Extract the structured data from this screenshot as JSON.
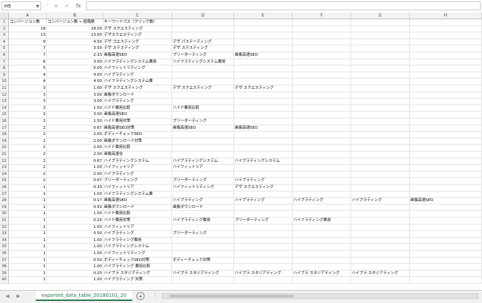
{
  "formula_bar": {
    "name_box": "H9",
    "cancel_icon": "×",
    "enter_icon": "✓",
    "fx_label": "fx",
    "formula": ""
  },
  "columns": [
    "A",
    "B",
    "C",
    "D",
    "E",
    "F",
    "G",
    "H"
  ],
  "header_row": {
    "a": "コンバージョン数",
    "b": "コンバージョン数 ÷ 経路数",
    "c": "キーワードパス（クリック数）"
  },
  "rows": [
    {
      "n": "2",
      "a": "18",
      "b": "18.00",
      "c": "デザ スクエスティング",
      "d": "",
      "e": "",
      "f": "",
      "g": "",
      "h": ""
    },
    {
      "n": "3",
      "a": "13",
      "b": "13.00",
      "c": "デザスクエスティング",
      "d": "",
      "e": "",
      "f": "",
      "g": "",
      "h": ""
    },
    {
      "n": "4",
      "a": "9",
      "b": "4.50",
      "c": "デザ コエスティング",
      "d": "デザ パステーティング",
      "e": "",
      "f": "",
      "g": "",
      "h": ""
    },
    {
      "n": "5",
      "a": "7",
      "b": "3.50",
      "c": "デザ ステスティング",
      "d": "デザ ステスティング",
      "e": "",
      "f": "",
      "g": "",
      "h": ""
    },
    {
      "n": "6",
      "a": "7",
      "b": "2.33",
      "c": "画像高速SEO",
      "d": "ブリーダーティング",
      "e": "画像高速SEO",
      "f": "",
      "g": "",
      "h": ""
    },
    {
      "n": "7",
      "a": "6",
      "b": "3.00",
      "c": "ハイフラティングシステム費用",
      "d": "ハイフラティングシステム費用",
      "e": "",
      "f": "",
      "g": "",
      "h": ""
    },
    {
      "n": "8",
      "a": "5",
      "b": "5.00",
      "c": "ハイフィットリティング",
      "d": "",
      "e": "",
      "f": "",
      "g": "",
      "h": ""
    },
    {
      "n": "9",
      "a": "4",
      "b": "4.00",
      "c": "ハイブラティング",
      "d": "",
      "e": "",
      "f": "",
      "g": "",
      "h": ""
    },
    {
      "n": "10",
      "a": "4",
      "b": "4.00",
      "c": "ハイフラティングシステム費",
      "d": "",
      "e": "",
      "f": "",
      "g": "",
      "h": ""
    },
    {
      "n": "11",
      "a": "3",
      "b": "1.00",
      "c": "デザ スクエスティング",
      "d": "デザ スクエスティング",
      "e": "デザ スクエスティング",
      "f": "",
      "g": "",
      "h": ""
    },
    {
      "n": "12",
      "a": "3",
      "b": "3.00",
      "c": "画像ダウンロード",
      "d": "",
      "e": "",
      "f": "",
      "g": "",
      "h": ""
    },
    {
      "n": "13",
      "a": "3",
      "b": "3.00",
      "c": "ハイブラティング",
      "d": "",
      "e": "",
      "f": "",
      "g": "",
      "h": ""
    },
    {
      "n": "14",
      "a": "3",
      "b": "1.50",
      "c": "ハイド費用比較",
      "d": "ハイド費用比較",
      "e": "",
      "f": "",
      "g": "",
      "h": ""
    },
    {
      "n": "15",
      "a": "3",
      "b": "3.00",
      "c": "画像高速SEO",
      "d": "",
      "e": "",
      "f": "",
      "g": "",
      "h": ""
    },
    {
      "n": "16",
      "a": "3",
      "b": "1.50",
      "c": "ハイド費用対策",
      "d": "ブリーダーティング",
      "e": "",
      "f": "",
      "g": "",
      "h": ""
    },
    {
      "n": "17",
      "a": "2",
      "b": "0.67",
      "c": "画像高速SEO対策",
      "d": "画像高速SEO",
      "e": "画像高速SEO",
      "f": "",
      "g": "",
      "h": ""
    },
    {
      "n": "18",
      "a": "2",
      "b": "2.00",
      "c": "ボディーチェックSEO",
      "d": "",
      "e": "",
      "f": "",
      "g": "",
      "h": ""
    },
    {
      "n": "19",
      "a": "2",
      "b": "2.00",
      "c": "画像ダウンロード対策",
      "d": "",
      "e": "",
      "f": "",
      "g": "",
      "h": ""
    },
    {
      "n": "20",
      "a": "2",
      "b": "2.00",
      "c": "ハイド費用比較",
      "d": "",
      "e": "",
      "f": "",
      "g": "",
      "h": ""
    },
    {
      "n": "21",
      "a": "2",
      "b": "2.00",
      "c": "画像高速化",
      "d": "",
      "e": "",
      "f": "",
      "g": "",
      "h": ""
    },
    {
      "n": "22",
      "a": "2",
      "b": "0.67",
      "c": "ハイブラティングシステム",
      "d": "ハイブラティングシステム",
      "e": "ハイブラティングシステム",
      "f": "",
      "g": "",
      "h": ""
    },
    {
      "n": "23",
      "a": "2",
      "b": "1.00",
      "c": "ハイフィットリア",
      "d": "ハイフィットリア",
      "e": "",
      "f": "",
      "g": "",
      "h": ""
    },
    {
      "n": "24",
      "a": "2",
      "b": "2.00",
      "c": "ハイブラティング",
      "d": "",
      "e": "",
      "f": "",
      "g": "",
      "h": ""
    },
    {
      "n": "25",
      "a": "2",
      "b": "0.67",
      "c": "ブリーダーティング",
      "d": "ブリーダーティング",
      "e": "ハイブラティング",
      "f": "",
      "g": "",
      "h": ""
    },
    {
      "n": "26",
      "a": "1",
      "b": "0.33",
      "c": "ハイフィットリア",
      "d": "ハイフィットリティング",
      "e": "デザ スクエスティング",
      "f": "",
      "g": "",
      "h": ""
    },
    {
      "n": "27",
      "a": "1",
      "b": "1.00",
      "c": "ハイフラティングシステム費",
      "d": "",
      "e": "",
      "f": "",
      "g": "",
      "h": ""
    },
    {
      "n": "28",
      "a": "1",
      "b": "0.17",
      "c": "画像高速SEO",
      "d": "ハイブラティング",
      "e": "ハイブラティング",
      "f": "ハイブラティング",
      "g": "ハイブラティング",
      "h": "画像高速SEO"
    },
    {
      "n": "29",
      "a": "1",
      "b": "0.50",
      "c": "画像ダウンロード",
      "d": "画像ダウンロード",
      "e": "",
      "f": "",
      "g": "",
      "h": ""
    },
    {
      "n": "30",
      "a": "1",
      "b": "1.00",
      "c": "ハイド費用比較",
      "d": "",
      "e": "",
      "f": "",
      "g": "",
      "h": ""
    },
    {
      "n": "31",
      "a": "1",
      "b": "0.25",
      "c": "ハイド費用対策",
      "d": "ハイブラティング費用",
      "e": "ブリーダーティング",
      "f": "ハイフラティング費用",
      "g": "",
      "h": ""
    },
    {
      "n": "32",
      "a": "1",
      "b": "1.00",
      "c": "ハイフィットリア",
      "d": "",
      "e": "",
      "f": "",
      "g": "",
      "h": ""
    },
    {
      "n": "33",
      "a": "1",
      "b": "0.50",
      "c": "ハイブラティング",
      "d": "ブリーダーティング",
      "e": "",
      "f": "",
      "g": "",
      "h": ""
    },
    {
      "n": "34",
      "a": "1",
      "b": "1.00",
      "c": "ハイフラティング費用",
      "d": "",
      "e": "",
      "f": "",
      "g": "",
      "h": ""
    },
    {
      "n": "35",
      "a": "1",
      "b": "1.00",
      "c": "ハイブラティングシステム",
      "d": "",
      "e": "",
      "f": "",
      "g": "",
      "h": ""
    },
    {
      "n": "36",
      "a": "1",
      "b": "1.00",
      "c": "ハイフィットリティング",
      "d": "",
      "e": "",
      "f": "",
      "g": "",
      "h": ""
    },
    {
      "n": "37",
      "a": "1",
      "b": "0.50",
      "c": "ボディーチェックSEO対策",
      "d": "ボディーチェック対策",
      "e": "",
      "f": "",
      "g": "",
      "h": ""
    },
    {
      "n": "38",
      "a": "1",
      "b": "1.00",
      "c": "ハイブラティング 費用比較",
      "d": "",
      "e": "",
      "f": "",
      "g": "",
      "h": ""
    },
    {
      "n": "39",
      "a": "1",
      "b": "0.20",
      "c": "ハイブラ スタジアティング",
      "d": "ハイブラ スタジアティング",
      "e": "ハイブラ スタジアティング",
      "f": "ハイブラ スタジアティング",
      "g": "ハイブラ スタジアティング",
      "h": ""
    },
    {
      "n": "40",
      "a": "1",
      "b": "1.00",
      "c": "ハイブラティング 対策",
      "d": "",
      "e": "",
      "f": "",
      "g": "",
      "h": ""
    }
  ],
  "sheet_tabs": {
    "active": "exported_data_table_20180101_20",
    "add_label": "+"
  }
}
